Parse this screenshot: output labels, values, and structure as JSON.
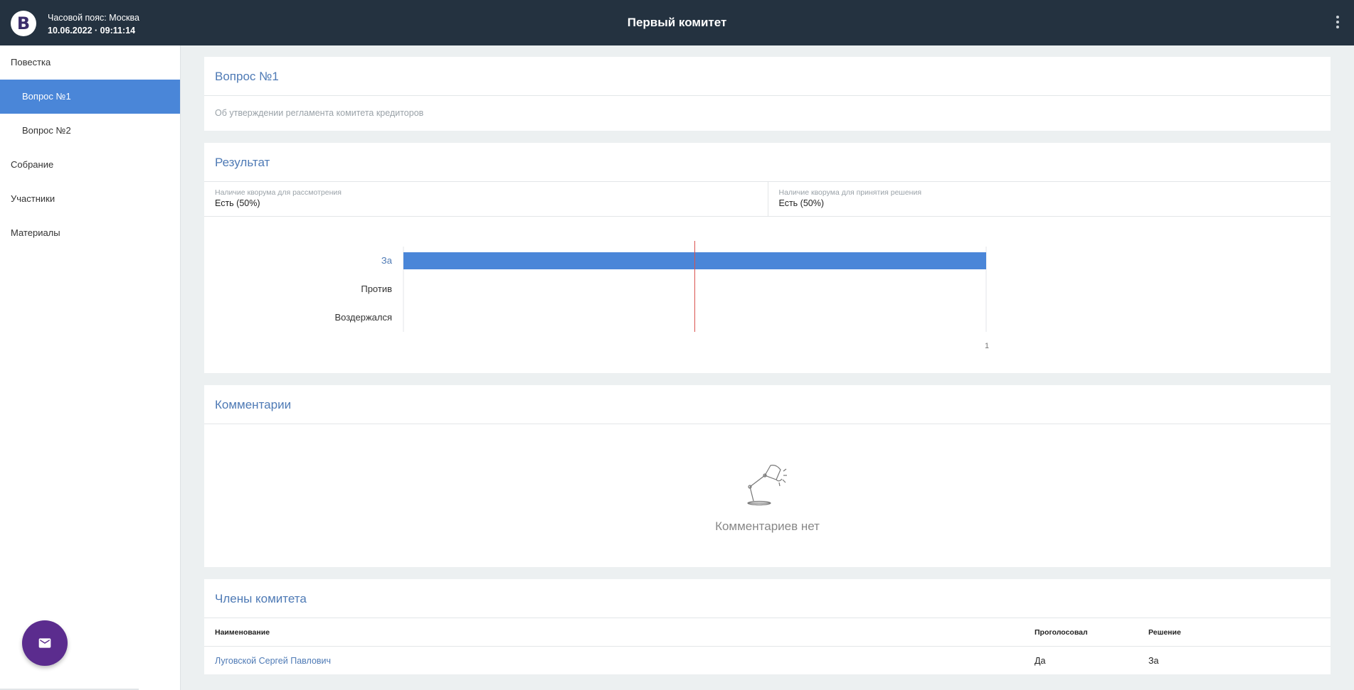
{
  "header": {
    "logo_letter": "B",
    "timezone": "Часовой пояс: Москва",
    "datetime": "10.06.2022 · 09:11:14",
    "title": "Первый комитет"
  },
  "sidebar": {
    "items": [
      {
        "label": "Повестка"
      },
      {
        "label": "Вопрос №1"
      },
      {
        "label": "Вопрос №2"
      },
      {
        "label": "Собрание"
      },
      {
        "label": "Участники"
      },
      {
        "label": "Материалы"
      }
    ]
  },
  "question": {
    "title": "Вопрос №1",
    "description": "Об утверждении регламента комитета кредиторов"
  },
  "result": {
    "title": "Результат",
    "quorum_consider_label": "Наличие кворума для рассмотрения",
    "quorum_consider_value": "Есть (50%)",
    "quorum_decision_label": "Наличие кворума для принятия решения",
    "quorum_decision_value": "Есть (50%)"
  },
  "chart_data": {
    "type": "bar",
    "orientation": "horizontal",
    "categories": [
      "За",
      "Против",
      "Воздержался"
    ],
    "values": [
      1,
      0,
      0
    ],
    "xlim": [
      0,
      1
    ],
    "x_ticks": [
      "1"
    ],
    "threshold": 0.5,
    "colors": {
      "bar": "#4a86d8",
      "threshold": "#d9534f",
      "highlight_label": "#4e7ab5"
    }
  },
  "comments": {
    "title": "Комментарии",
    "empty_text": "Комментариев нет"
  },
  "members": {
    "title": "Члены комитета",
    "columns": [
      "Наименование",
      "Проголосовал",
      "Решение"
    ],
    "rows": [
      {
        "name": "Луговской Сергей Павлович",
        "voted": "Да",
        "decision": "За"
      }
    ]
  },
  "icons": {
    "fab": "mail-icon",
    "menu": "kebab-menu-icon",
    "empty": "desk-lamp-icon"
  }
}
